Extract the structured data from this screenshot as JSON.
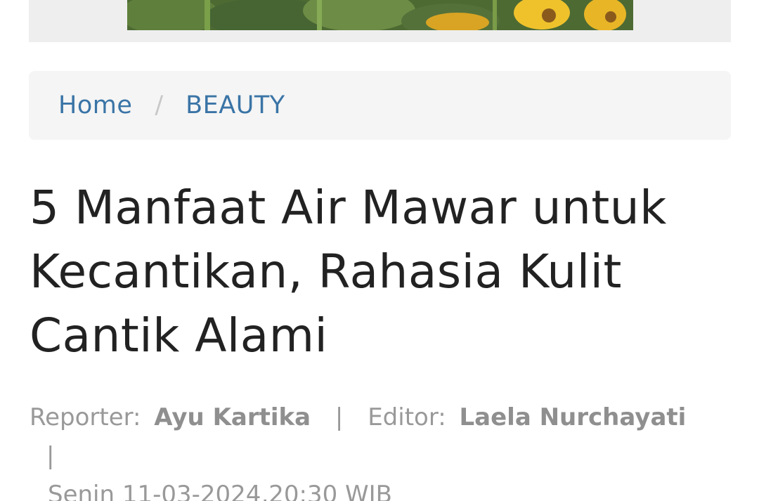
{
  "banner": {
    "image_name": "sunflower-image"
  },
  "breadcrumb": {
    "home_label": "Home",
    "separator": "/",
    "category_label": "BEAUTY"
  },
  "article": {
    "title": "5 Manfaat Air Mawar untuk Kecantikan, Rahasia Kulit Cantik Alami",
    "reporter_label": "Reporter:",
    "reporter_name": "Ayu Kartika",
    "editor_label": "Editor:",
    "editor_name": "Laela Nurchayati",
    "separator": "|",
    "date": "Senin 11-03-2024,20:30 WIB"
  },
  "colors": {
    "link": "#3a74a6",
    "title": "#222222",
    "meta": "#999999",
    "breadcrumb_bg": "#f5f5f5"
  }
}
